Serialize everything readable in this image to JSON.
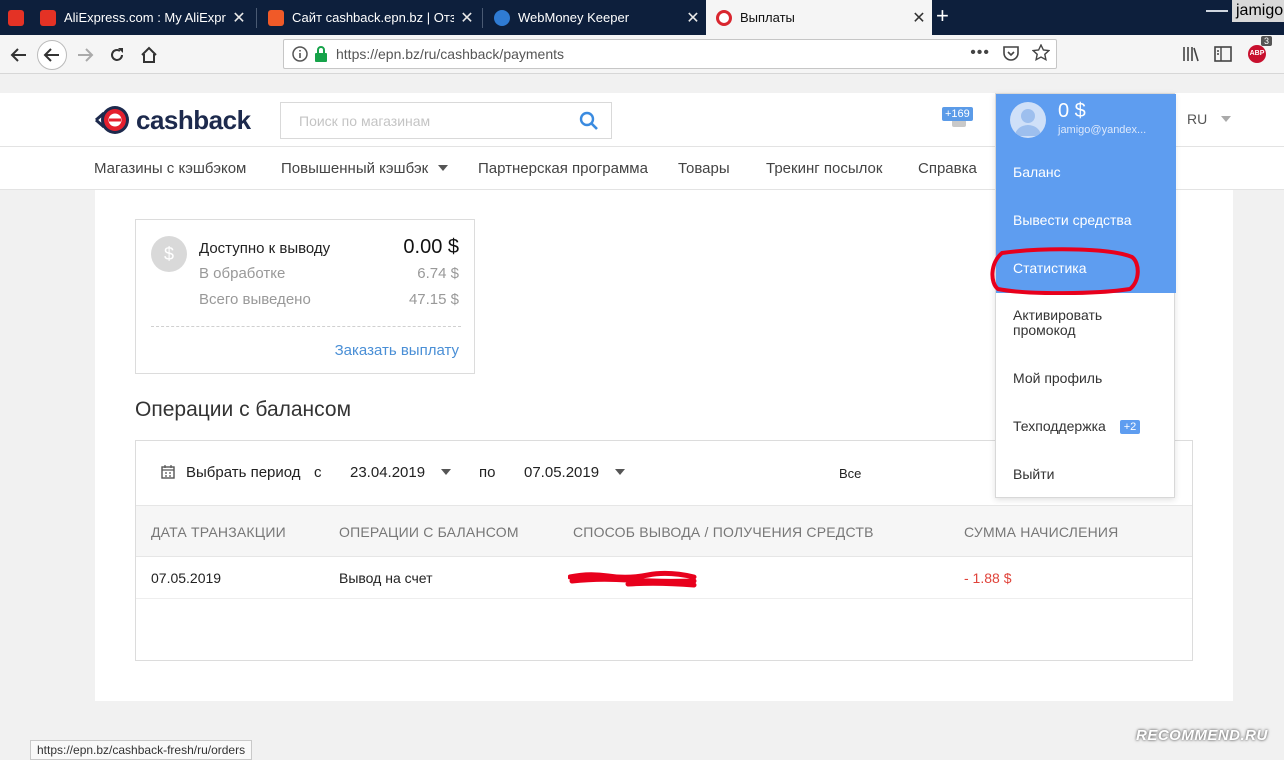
{
  "browser": {
    "tabs": [
      {
        "title": "",
        "active": false
      },
      {
        "title": "AliExpress.com : My AliExpress",
        "active": false
      },
      {
        "title": "Сайт cashback.epn.bz | Отзыв",
        "active": false
      },
      {
        "title": "WebMoney Keeper",
        "active": false
      },
      {
        "title": "Выплаты",
        "active": true
      }
    ],
    "user_chip": "jamigo",
    "url": "https://epn.bz/ru/cashback/payments",
    "adblock_count": "3",
    "status_url": "https://epn.bz/cashback-fresh/ru/orders"
  },
  "site": {
    "logo_text": "cashback",
    "search_placeholder": "Поиск по магазинам",
    "notif_badge": "+169",
    "lang": "RU",
    "menu": [
      "Магазины с кэшбэком",
      "Повышенный кэшбэк",
      "Партнерская программа",
      "Товары",
      "Трекинг посылок",
      "Справка"
    ]
  },
  "balance": {
    "available_label": "Доступно к выводу",
    "available_value": "0.00 $",
    "processing_label": "В обработке",
    "processing_value": "6.74 $",
    "withdrawn_label": "Всего выведено",
    "withdrawn_value": "47.15 $",
    "order_link": "Заказать выплату"
  },
  "operations": {
    "title": "Операции с балансом",
    "period_label": "Выбрать период",
    "from_label": "с",
    "from_date": "23.04.2019",
    "to_label": "по",
    "to_date": "07.05.2019",
    "type_filter": "Все",
    "columns": [
      "ДАТА ТРАНЗАКЦИИ",
      "ОПЕРАЦИИ С БАЛАНСОМ",
      "СПОСОБ ВЫВОДА / ПОЛУЧЕНИЯ СРЕДСТВ",
      "СУММА НАЧИСЛЕНИЯ"
    ],
    "rows": [
      {
        "date": "07.05.2019",
        "operation": "Вывод на счет",
        "method": "",
        "amount": "- 1.88 $"
      }
    ]
  },
  "dropdown": {
    "balance": "0 $",
    "email": "jamigo@yandex...",
    "items": [
      "Баланс",
      "Вывести средства",
      "Статистика",
      "Активировать промокод",
      "Мой профиль",
      "Техподдержка",
      "Выйти"
    ],
    "support_badge": "+2"
  },
  "watermark": "RECOMMEND.RU",
  "colors": {
    "accent": "#5e9df0",
    "negative": "#e0433a",
    "tabbar": "#0d1f3c",
    "annotation": "#e8001c"
  }
}
